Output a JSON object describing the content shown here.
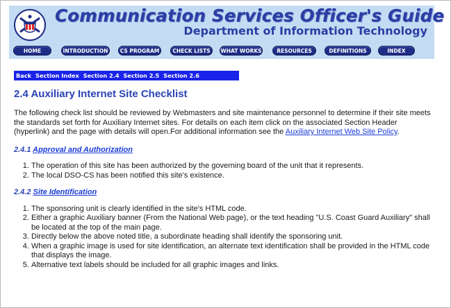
{
  "header": {
    "title": "Communication Services Officer's Guide",
    "subtitle": "Department of Information Technology",
    "logo_icon": "coast-guard-auxiliary-seal-icon",
    "colors": {
      "banner_bg": "#c4dcf3",
      "title": "#2b3ea3",
      "nav_button": "#1f2d86"
    }
  },
  "nav": {
    "items": [
      {
        "label": "HOME"
      },
      {
        "label": "INTRODUCTION"
      },
      {
        "label": "CS PROGRAM"
      },
      {
        "label": "CHECK LISTS"
      },
      {
        "label": "WHAT WORKS"
      },
      {
        "label": "RESOURCES"
      },
      {
        "label": "DEFINITIONS"
      },
      {
        "label": "INDEX"
      }
    ]
  },
  "section_nav": {
    "items": [
      {
        "label": "Back"
      },
      {
        "label": "Section Index"
      },
      {
        "label": "Section 2.4"
      },
      {
        "label": "Section 2.5"
      },
      {
        "label": "Section 2.6"
      }
    ],
    "bg_color": "#1a23e8"
  },
  "main": {
    "heading": "2.4 Auxiliary Internet Site Checklist",
    "intro_text": "The following check list should be reviewed by Webmasters and site maintenance personnel to determine if their site meets the standards set forth for Auxiliary Internet sites. For details on each item click on the associated Section Header (hyperlink) and the page with details will open.For additional information see the ",
    "intro_link": "Auxiliary Internet Web Site Policy",
    "intro_end": ".",
    "sections": [
      {
        "number": "2.4.1",
        "title": "Approval and Authorization",
        "items": [
          "The operation of this site has been authorized by the governing board of the unit that it represents.",
          "The local DSO-CS has been notified this site's existence."
        ]
      },
      {
        "number": "2.4.2",
        "title": "Site Identification",
        "items": [
          "The sponsoring unit is clearly identified in the site's HTML code.",
          "Either a graphic Auxiliary banner (From the National Web page), or the text heading \"U.S. Coast Guard Auxiliary\" shall be located at the top of the main page.",
          "Directly below the above noted title, a subordinate heading shall identify the sponsoring unit.",
          "When a graphic image is used for site identification, an alternate text identification shall be provided in the HTML code that displays the image.",
          "Alternative text labels should be included for all graphic images and links."
        ]
      }
    ]
  }
}
